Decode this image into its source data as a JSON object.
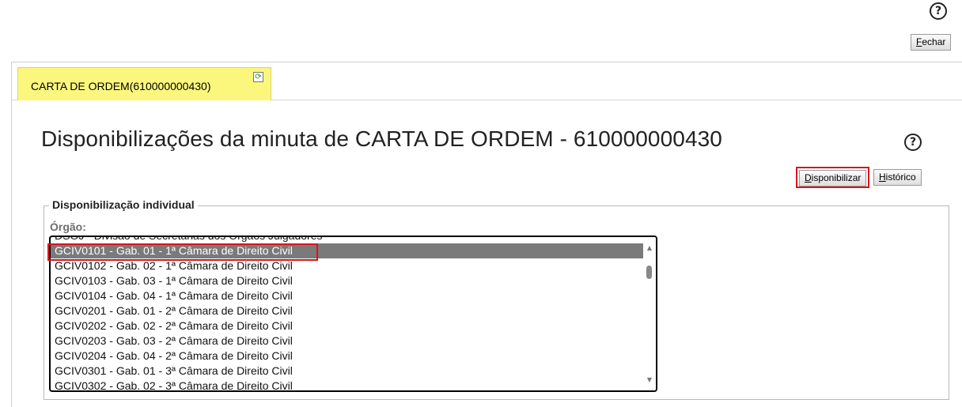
{
  "help_icon_glyph": "?",
  "header": {
    "close_label_u": "F",
    "close_label_rest": "echar"
  },
  "tab": {
    "label": "CARTA DE ORDEM(610000000430)",
    "refresh_icon": "refresh-icon",
    "refresh_glyph": "⟳"
  },
  "page": {
    "title": "Disponibilizações da minuta de CARTA DE ORDEM - 610000000430"
  },
  "toolbar": {
    "disponibilizar_u": "D",
    "disponibilizar_rest": "isponibilizar",
    "historico_u": "H",
    "historico_rest": "istórico"
  },
  "fieldset": {
    "legend": "Disponibilização individual",
    "orgao_label": "Órgão:"
  },
  "orgao_list": {
    "options": [
      "DSOJ - Divisão de Secretarias dos Órgãos Julgadores",
      "GCIV0101 - Gab. 01 - 1ª Câmara de Direito Civil",
      "GCIV0102 - Gab. 02 - 1ª Câmara de Direito Civil",
      "GCIV0103 - Gab. 03 - 1ª Câmara de Direito Civil",
      "GCIV0104 - Gab. 04 - 1ª Câmara de Direito Civil",
      "GCIV0201 - Gab. 01 - 2ª Câmara de Direito Civil",
      "GCIV0202 - Gab. 02 - 2ª Câmara de Direito Civil",
      "GCIV0203 - Gab. 03 - 2ª Câmara de Direito Civil",
      "GCIV0204 - Gab. 04 - 2ª Câmara de Direito Civil",
      "GCIV0301 - Gab. 01 - 3ª Câmara de Direito Civil",
      "GCIV0302 - Gab. 02 - 3ª Câmara de Direito Civil"
    ],
    "selected_index": 1
  },
  "colors": {
    "tab_bg": "#fbf77d",
    "highlight": "#d9141b",
    "selected_bg": "#7a7a7a"
  }
}
